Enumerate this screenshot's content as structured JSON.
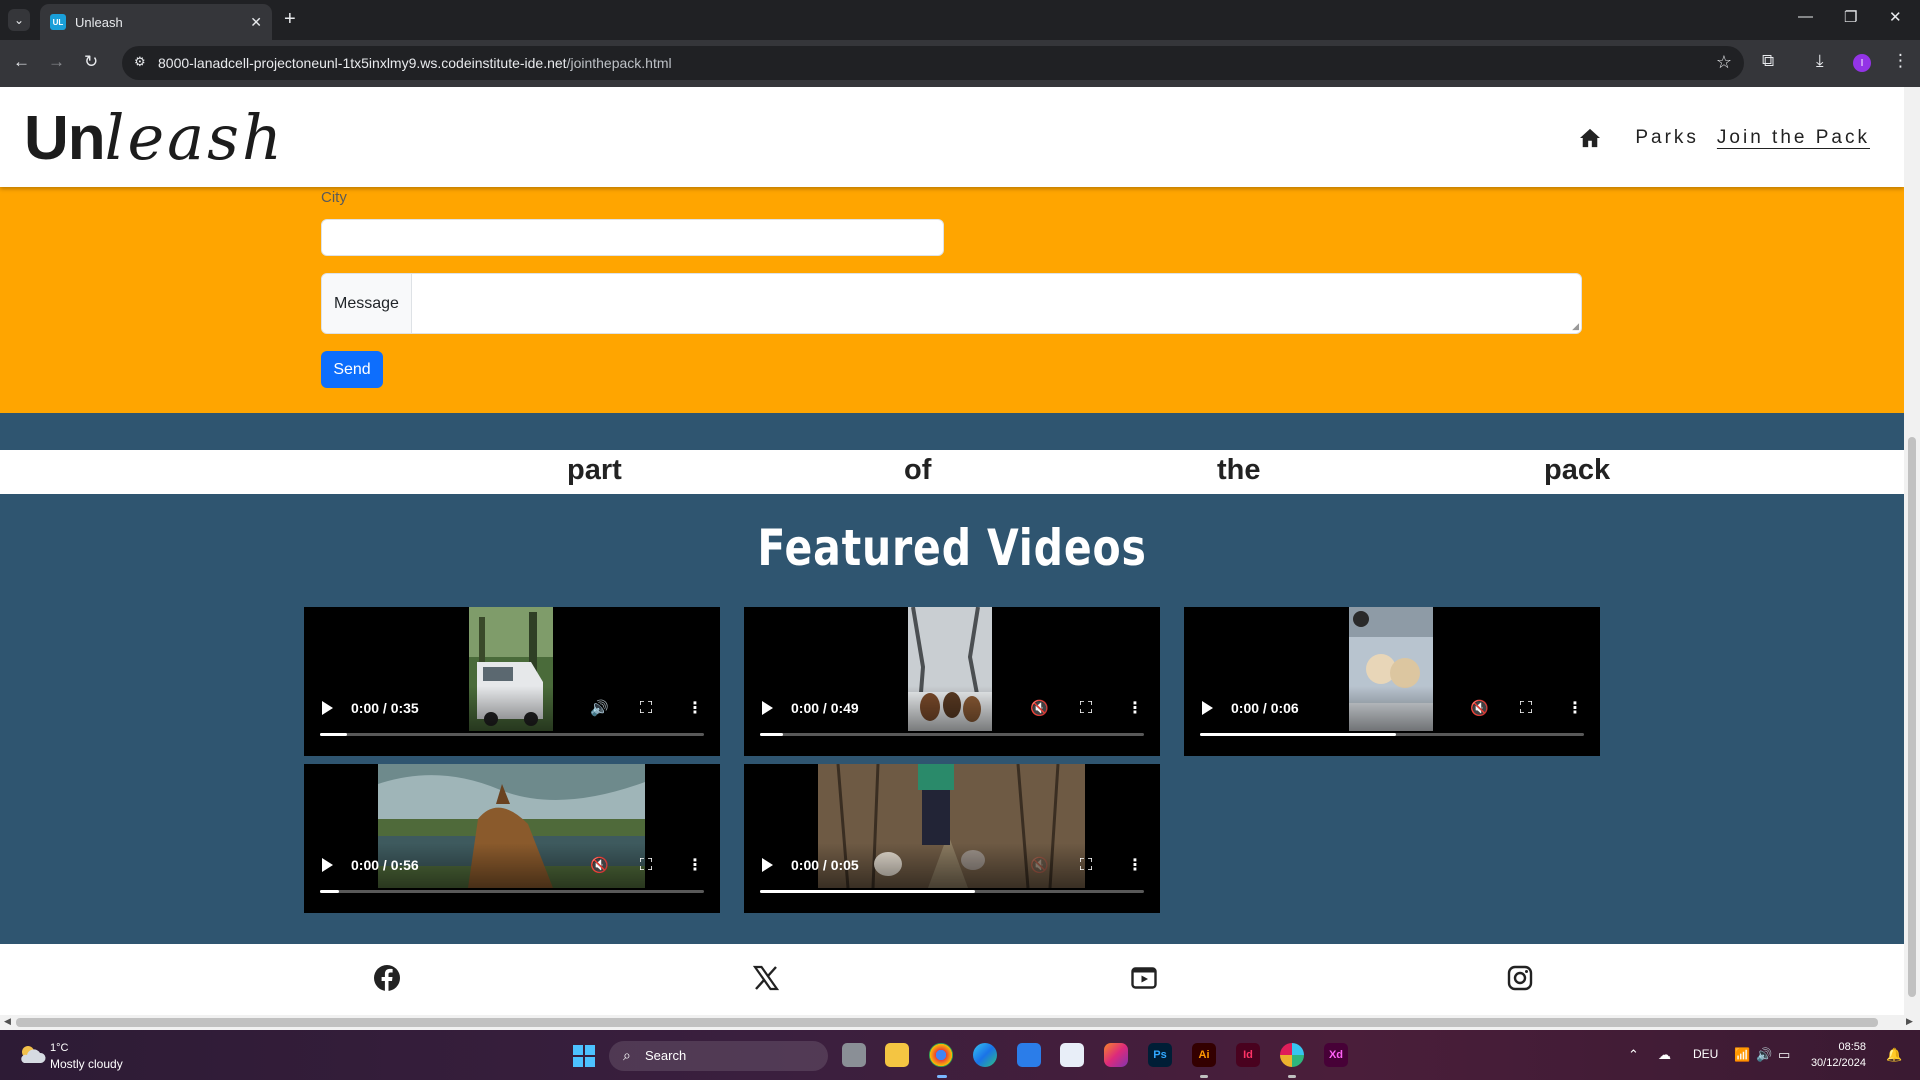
{
  "browser": {
    "tab_title": "Unleash",
    "tab_favicon_text": "UL",
    "url_host": "8000-lanadcell-projectoneunl-1tx5inxlmy9.ws.codeinstitute-ide.net",
    "url_path": "/jointhepack.html",
    "profile_initial": "I"
  },
  "site": {
    "logo_bold": "Un",
    "logo_italic": "leash",
    "nav": {
      "home_icon": "house-icon",
      "parks": "Parks",
      "join": "Join the Pack"
    }
  },
  "form": {
    "city_label": "City",
    "city_value": "",
    "message_label": "Message",
    "message_value": "",
    "send_label": "Send"
  },
  "words": [
    "part",
    "of",
    "the",
    "pack"
  ],
  "videos_title": "Featured Videos",
  "videos": [
    {
      "time": "0:00 / 0:35",
      "progress": 0.07,
      "muted": false,
      "subject": "van in forest"
    },
    {
      "time": "0:00 / 0:49",
      "progress": 0.06,
      "muted": true,
      "subject": "dogs in snowy forest"
    },
    {
      "time": "0:00 / 0:06",
      "progress": 0.51,
      "muted": true,
      "subject": "fluffy dogs in snow"
    },
    {
      "time": "0:00 / 0:56",
      "progress": 0.05,
      "muted": true,
      "subject": "dog by lake"
    },
    {
      "time": "0:00 / 0:05",
      "progress": 0.56,
      "muted": true,
      "subject": "person walking dogs on trail"
    }
  ],
  "footer": {
    "icons": [
      "facebook-icon",
      "x-icon",
      "youtube-icon",
      "instagram-icon"
    ]
  },
  "taskbar": {
    "temperature": "1°C",
    "weather": "Mostly cloudy",
    "search_placeholder": "Search",
    "language": "DEU",
    "time": "08:58",
    "date": "30/12/2024"
  },
  "colors": {
    "header_bg": "#ffffff",
    "form_bg": "#ffa500",
    "section_bg": "#2f5570",
    "send_button": "#0d6efd"
  }
}
